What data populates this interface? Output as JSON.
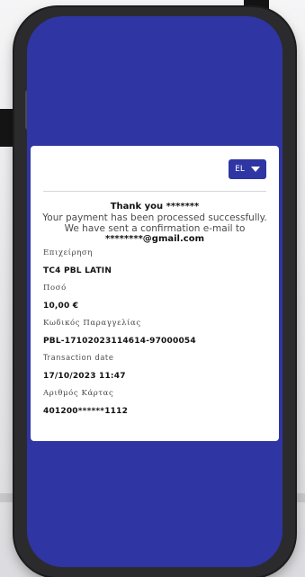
{
  "lang_selector": {
    "value": "EL"
  },
  "message": {
    "thanks": "Thank you *******",
    "processed": "Your payment has been processed successfully.",
    "sent": "We have sent a confirmation e-mail to",
    "email": "********@gmail.com"
  },
  "details": [
    {
      "label": "Επιχείρηση",
      "value": "TC4 PBL LATIN"
    },
    {
      "label": "Ποσό",
      "value": "10,00 €"
    },
    {
      "label": "Κωδικός Παραγγελίας",
      "value": "PBL-17102023114614-97000054"
    },
    {
      "label": "Transaction date",
      "value": "17/10/2023 11:47"
    },
    {
      "label": "Αριθμός Κάρτας",
      "value": "401200******1112"
    }
  ],
  "colors": {
    "brand_blue": "#2f35a3",
    "card_bg": "#ffffff",
    "phone_frame": "#2b2b2e"
  }
}
